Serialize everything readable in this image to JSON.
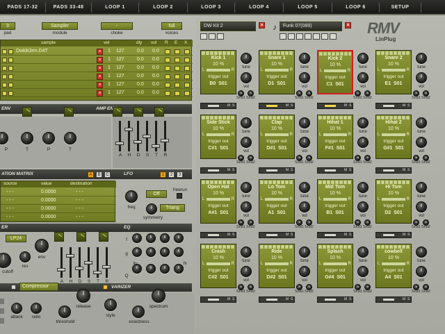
{
  "tabs": [
    "PADS 17-32",
    "PADS 33-48",
    "LOOP 1",
    "LOOP 2",
    "LOOP 3",
    "LOOP 4",
    "LOOP 5",
    "LOOP 6",
    "SETUP"
  ],
  "header": {
    "pad_value": "3",
    "pad_label": "pad",
    "module_value": "Sampler",
    "module_label": "module",
    "choke_value": "-",
    "choke_label": "choke",
    "voices_value": "full",
    "voices_label": "voices",
    "kit_name": "DW Kit 2",
    "loop_name": "Funk 07(089)",
    "logo_main": "RMV",
    "logo_sub": "LinPlug"
  },
  "sample_table": {
    "headers": [
      "sample",
      "vel",
      "dly",
      "vol",
      "R",
      "E",
      "X"
    ],
    "rows": [
      {
        "name": "Dwkik3rm.D4T",
        "c1": "1",
        "vel": "127",
        "dly": "0.0",
        "vol": "0.0"
      },
      {
        "name": "",
        "c1": "1",
        "vel": "127",
        "dly": "0.0",
        "vol": "0.0"
      },
      {
        "name": "",
        "c1": "1",
        "vel": "127",
        "dly": "0.0",
        "vol": "0.0"
      },
      {
        "name": "",
        "c1": "1",
        "vel": "127",
        "dly": "0.0",
        "vol": "0.0"
      },
      {
        "name": "",
        "c1": "1",
        "vel": "127",
        "dly": "0.0",
        "vol": "0.0"
      },
      {
        "name": "",
        "c1": "1",
        "vel": "127",
        "dly": "0.0",
        "vol": "0.0"
      }
    ]
  },
  "sections": {
    "env": "ENV",
    "amp_env": "AMP ENV",
    "mod_matrix": "ATION MATRIX",
    "lfo": "LFO",
    "filter": "ER",
    "eq": "EQ",
    "varizer": "VARIZER"
  },
  "env_knob_labels": [
    "P",
    "T",
    "P",
    "T"
  ],
  "amp_env_labels": [
    "A",
    "H",
    "D",
    "S",
    "T",
    "R"
  ],
  "matrix": {
    "headers": [
      "source",
      "value",
      "destination"
    ],
    "rows": [
      {
        "source": "- - -",
        "value": "0.0000",
        "destination": "- - -"
      },
      {
        "source": "- - -",
        "value": "0.0000",
        "destination": "- - -"
      },
      {
        "source": "- - -",
        "value": "0.0000",
        "destination": "- - -"
      },
      {
        "source": "- - -",
        "value": "0.0000",
        "destination": "- - -"
      }
    ],
    "page_buttons": [
      "A",
      "B",
      "C"
    ]
  },
  "lfo": {
    "page_buttons": [
      "1",
      "2",
      "3"
    ],
    "freerun_label": "freerun",
    "on_off_value": "Off",
    "wave_value": "Triang",
    "freq_label": "freq",
    "symmetry_label": "symmetry"
  },
  "filter": {
    "type_value": "LP24",
    "env_label": "env",
    "res_label": "res",
    "cutoff_label": "cutoff",
    "fader_labels": [
      "A",
      "H",
      "D",
      "S",
      "T",
      "R"
    ]
  },
  "eq": {
    "row_labels": [
      "f",
      "g",
      "lo",
      "hi",
      "Q"
    ]
  },
  "fx": {
    "compressor_value": "Compressor",
    "attack_label": "attack",
    "ratio_label": "ratio",
    "release_label": "release",
    "threshold_label": "threshold",
    "style_label": "style",
    "spectrum_label": "spectrum",
    "exactness_label": "exactness"
  },
  "pads": [
    {
      "name": "Kick 1",
      "pct": "10 %",
      "note": "B0",
      "slot": "S01",
      "selected": false
    },
    {
      "name": "Snare 1",
      "pct": "10 %",
      "note": "D1",
      "slot": "S01",
      "selected": false
    },
    {
      "name": "Kick 2",
      "pct": "10 %",
      "note": "C1",
      "slot": "S01",
      "selected": true
    },
    {
      "name": "Snare 2",
      "pct": "10 %",
      "note": "E1",
      "slot": "S01",
      "selected": false
    },
    {
      "name": "Side Stick",
      "pct": "10 %",
      "note": "C#1",
      "slot": "S01",
      "selected": false
    },
    {
      "name": "Clap",
      "pct": "10 %",
      "note": "D#1",
      "slot": "S01",
      "selected": false
    },
    {
      "name": "Hihat 1",
      "pct": "10 %",
      "note": "F#1",
      "slot": "S01",
      "selected": false
    },
    {
      "name": "Hihat 2",
      "pct": "10 %",
      "note": "G#1",
      "slot": "S01",
      "selected": false
    },
    {
      "name": "Open Hat",
      "pct": "10 %",
      "note": "A#1",
      "slot": "S01",
      "selected": false
    },
    {
      "name": "Lo Tom",
      "pct": "10 %",
      "note": "A1",
      "slot": "S01",
      "selected": false
    },
    {
      "name": "Mid Tom",
      "pct": "10 %",
      "note": "B1",
      "slot": "S01",
      "selected": false
    },
    {
      "name": "Hi Tom",
      "pct": "10 %",
      "note": "D2",
      "slot": "S01",
      "selected": false
    },
    {
      "name": "Crash",
      "pct": "10 %",
      "note": "C#2",
      "slot": "S01",
      "selected": false
    },
    {
      "name": "Ride",
      "pct": "10 %",
      "note": "D#2",
      "slot": "S01",
      "selected": false
    },
    {
      "name": "Splash",
      "pct": "10 %",
      "note": "G#4",
      "slot": "S01",
      "selected": false
    },
    {
      "name": "cowbell",
      "pct": "10 %",
      "note": "A4",
      "slot": "S01",
      "selected": false
    }
  ],
  "pad_common": {
    "trigger_label": "trigger out",
    "tune_label": "tune",
    "vol_label": "vol",
    "snd1_label": "Snd1",
    "snd2_label": "Snd2",
    "l_label": "L",
    "r_label": "R",
    "m_label": "M",
    "s_label": "S"
  },
  "colors": {
    "lcd_green": "#7f8a2d",
    "select_red": "#d21e1e",
    "panel_gray": "#b0b2ab",
    "tab_bg": "#1e1f1c",
    "trigger_highlight": "#f6d94b"
  }
}
